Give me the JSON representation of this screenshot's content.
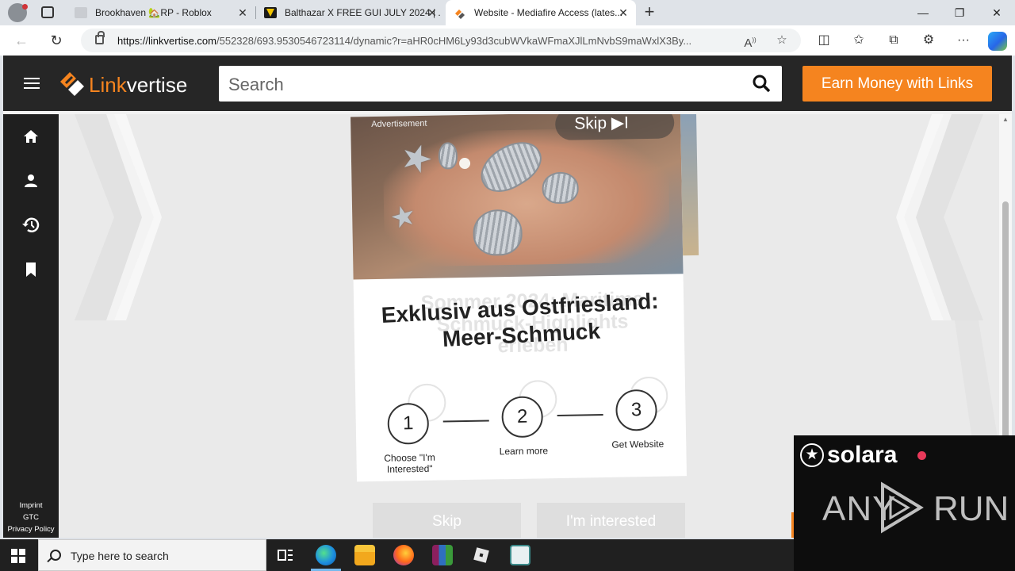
{
  "browser": {
    "tabs": [
      {
        "title": "Brookhaven 🏡RP - Roblox",
        "active": false,
        "favicon_color": "#c9ccd1"
      },
      {
        "title": "Balthazar X FREE GUI JULY 2024 | ...",
        "active": false,
        "favicon_color": "#1b1b1b"
      },
      {
        "title": "Website - Mediafire Access (lates...",
        "active": true,
        "favicon_color": "#f5841f"
      }
    ],
    "new_tab": "+",
    "window_controls": {
      "minimize": "—",
      "maximize": "❐",
      "close": "✕"
    },
    "address": {
      "host": "https://linkvertise.com",
      "path": "/552328/693.9530546723114/dynamic?r=aHR0cHM6Ly93d3cubWVkaWFmaXJlLmNvbS9maWxlX3By..."
    },
    "toolbar_icons": [
      "read-aloud-icon",
      "favorite-icon",
      "split-screen-icon",
      "favorites-icon",
      "collections-icon",
      "extensions-icon",
      "more-icon",
      "copilot-icon"
    ]
  },
  "header": {
    "logo_prefix": "Link",
    "logo_suffix": "vertise",
    "search_placeholder": "Search",
    "earn_button": "Earn Money with Links"
  },
  "sidebar": {
    "items": [
      "home-icon",
      "user-icon",
      "history-icon",
      "bookmark-icon"
    ],
    "footer": [
      "Imprint",
      "GTC",
      "Privacy Policy"
    ]
  },
  "ad": {
    "label": "Advertisement",
    "skip_pill": "Skip ▶I",
    "title": "Exklusiv aus Ostfriesland: Meer-Schmuck",
    "ghost_title": "Sommer 2024: Maritime Schmuck-Highlights erleben",
    "steps": [
      {
        "num": "1",
        "label": "Choose \"I'm Interested\""
      },
      {
        "num": "2",
        "label": "Learn more"
      },
      {
        "num": "3",
        "label": "Get Website"
      }
    ]
  },
  "actions": {
    "skip": "Skip",
    "interested": "I'm interested"
  },
  "taskbar": {
    "search_placeholder": "Type here to search",
    "apps": [
      "task-view-icon",
      "edge-icon",
      "file-explorer-icon",
      "firefox-icon",
      "winrar-icon",
      "roblox-icon",
      "app-icon"
    ]
  },
  "overlay": {
    "brand": "solara",
    "watermark_left": "ANY",
    "watermark_right": "RUN"
  },
  "colors": {
    "accent": "#f5841f",
    "header_bg": "#262626",
    "sidebar_bg": "#1f1f1f",
    "taskbar_bg": "#202020"
  }
}
